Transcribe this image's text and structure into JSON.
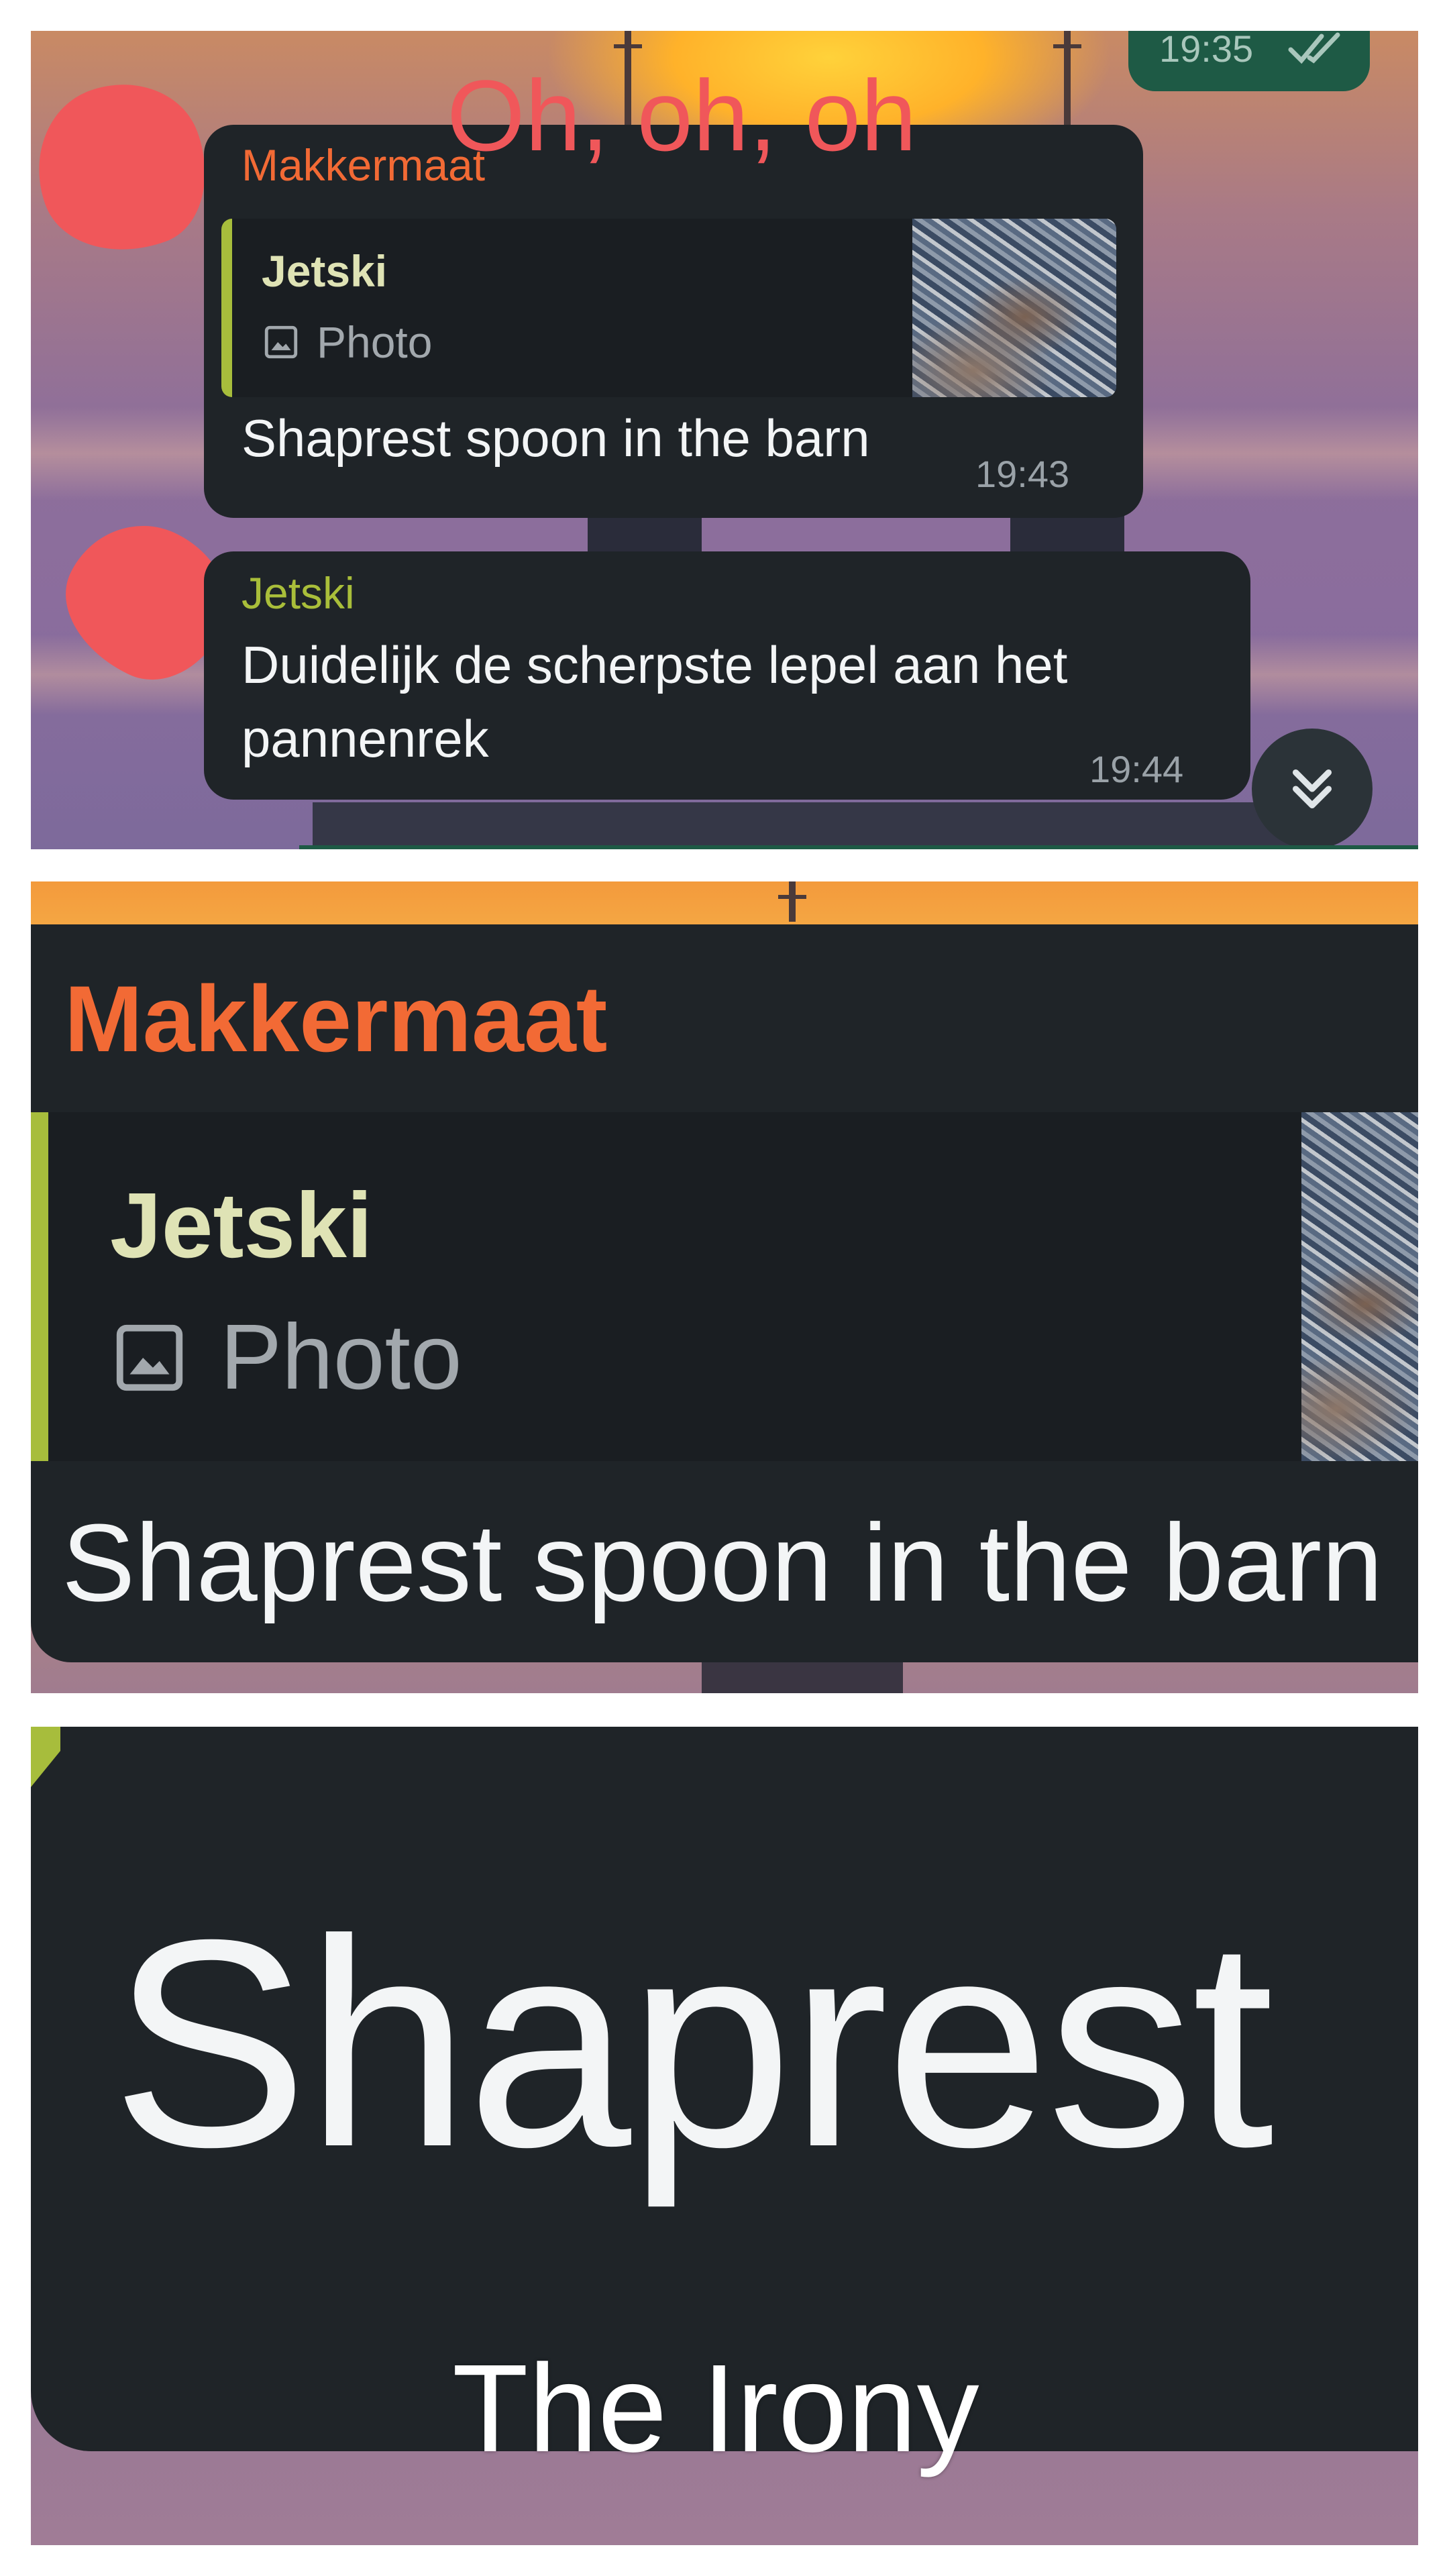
{
  "panel1": {
    "overlay_caption": "Oh, oh, oh",
    "sent_message": {
      "time": "19:35"
    },
    "messages": [
      {
        "sender": "Makkermaat",
        "sender_color": "#f26a35",
        "reply": {
          "name": "Jetski",
          "type": "Photo"
        },
        "text": "Shaprest spoon in the barn",
        "time": "19:43"
      },
      {
        "sender": "Jetski",
        "sender_color": "#a9be3a",
        "text_line1": "Duidelijk de scherpste lepel aan het",
        "text_line2": "pannenrek",
        "time": "19:44"
      }
    ],
    "scroll_icon": "chevron-double-down-icon"
  },
  "panel2": {
    "sender": "Makkermaat",
    "reply": {
      "name": "Jetski",
      "type": "Photo"
    },
    "text": "Shaprest spoon in the barn"
  },
  "panel3": {
    "zoom_word": "Shaprest",
    "caption": "The Irony"
  },
  "colors": {
    "bubble": "#1f2428",
    "reply_bar": "#a7bd3c",
    "scribble": "#f0575a",
    "sent_bubble": "#1e5a45"
  }
}
